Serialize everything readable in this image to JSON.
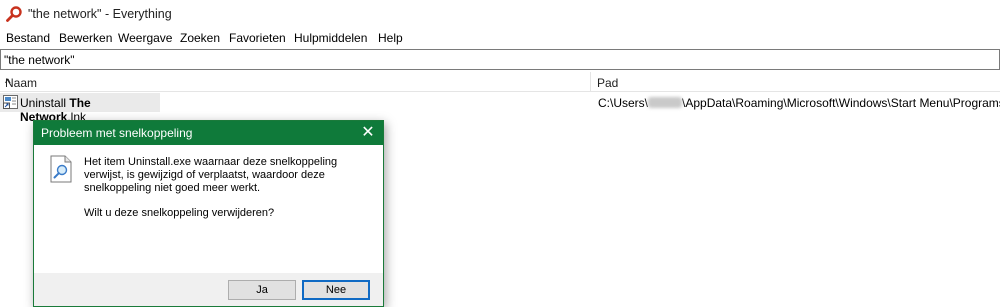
{
  "window": {
    "title": "\"the network\" - Everything"
  },
  "menu": [
    {
      "label": "Bestand"
    },
    {
      "label": "Bewerken"
    },
    {
      "label": "Weergave"
    },
    {
      "label": "Zoeken"
    },
    {
      "label": "Favorieten"
    },
    {
      "label": "Hulpmiddelen"
    },
    {
      "label": "Help"
    }
  ],
  "search": {
    "value": "\"the network\""
  },
  "columns": {
    "name": "Naam",
    "path": "Pad",
    "sort_indicator": "^"
  },
  "results": [
    {
      "name_prefix": "Uninstall ",
      "name_match": "The Network",
      "name_suffix": ".lnk",
      "path_prefix": "C:\\Users\\",
      "path_suffix": "\\AppData\\Roaming\\Microsoft\\Windows\\Start Menu\\Programs"
    }
  ],
  "dialog": {
    "title": "Probleem met snelkoppeling",
    "close": "✕",
    "message": "Het item Uninstall.exe waarnaar deze snelkoppeling verwijst, is gewijzigd of verplaatst, waardoor deze snelkoppeling niet goed meer werkt.",
    "question": "Wilt u deze snelkoppeling verwijderen?",
    "yes_label": "Ja",
    "no_label": "Nee"
  },
  "colors": {
    "dialog_title_bg": "#0f7a3a",
    "default_button_border": "#0f6ac4"
  }
}
